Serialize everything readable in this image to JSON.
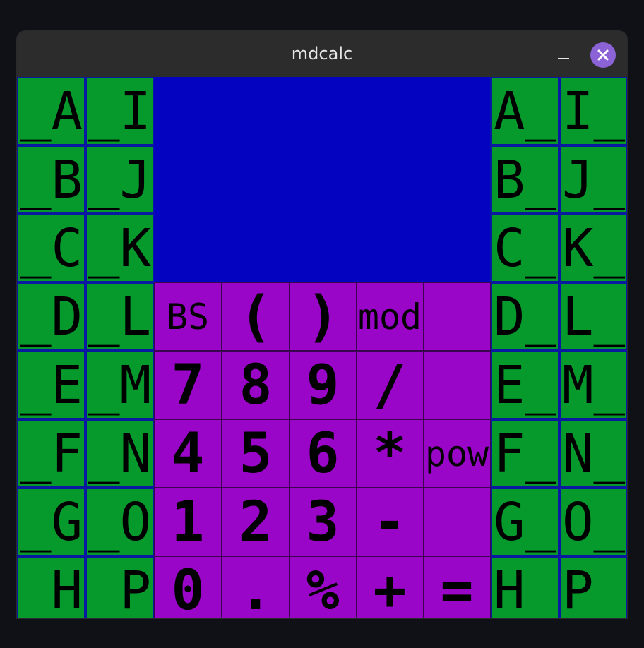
{
  "window": {
    "title": "mdcalc"
  },
  "left_buttons": [
    [
      "_A",
      "_I"
    ],
    [
      "_B",
      "_J"
    ],
    [
      "_C",
      "_K"
    ],
    [
      "_D",
      "_L"
    ],
    [
      "_E",
      "_M"
    ],
    [
      "_F",
      "_N"
    ],
    [
      "_G",
      "_O"
    ],
    [
      "_H",
      "_P"
    ]
  ],
  "right_buttons": [
    [
      "A_",
      "I_"
    ],
    [
      "B_",
      "J_"
    ],
    [
      "C_",
      "K_"
    ],
    [
      "D_",
      "L_"
    ],
    [
      "E_",
      "M_"
    ],
    [
      "F_",
      "N_"
    ],
    [
      "G_",
      "O_"
    ],
    [
      "H_",
      "P_"
    ]
  ],
  "keypad": [
    [
      "BS",
      "( ",
      ")",
      "mod",
      ""
    ],
    [
      "7",
      "8",
      "9",
      "/",
      ""
    ],
    [
      "4",
      "5",
      "6",
      "*",
      "pow"
    ],
    [
      "1",
      "2",
      "3",
      "-",
      ""
    ],
    [
      "0",
      ".",
      "%",
      "+",
      "="
    ]
  ],
  "colors": {
    "background": "#0a1aa0",
    "display": "#0303c0",
    "register_key": "#069a2c",
    "keypad_key": "#9a06c8",
    "close_button": "#8c63d6"
  }
}
